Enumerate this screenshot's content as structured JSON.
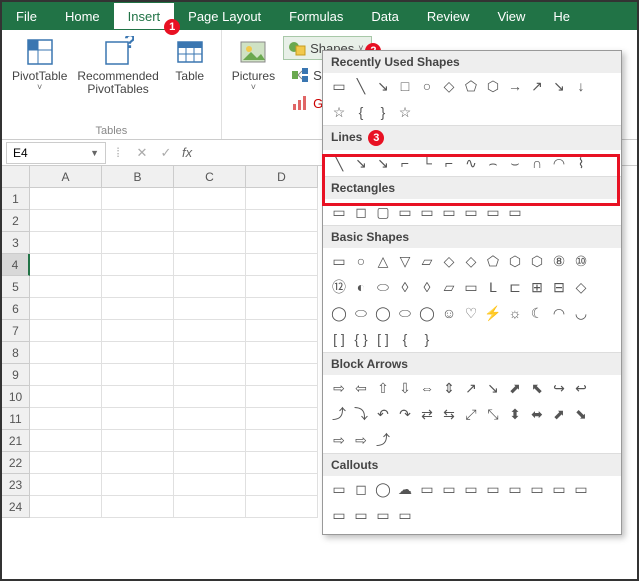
{
  "tabs": [
    "File",
    "Home",
    "Insert",
    "Page Layout",
    "Formulas",
    "Data",
    "Review",
    "View",
    "He"
  ],
  "active_tab": 2,
  "annotations": {
    "tab": "1",
    "shapes": "2",
    "lines": "3"
  },
  "ribbon": {
    "tables_group": "Tables",
    "pivottable": "PivotTable",
    "recommended": "Recommended\nPivotTables",
    "table": "Table",
    "pictures": "Pictures",
    "shapes": "Shapes",
    "smartart": "SmartArt",
    "g": "G"
  },
  "namebox": "E4",
  "fx": "fx",
  "cancel": "✕",
  "accept": "✓",
  "cols": [
    "A",
    "B",
    "C",
    "D"
  ],
  "rows": [
    "1",
    "2",
    "3",
    "4",
    "5",
    "6",
    "7",
    "8",
    "9",
    "10",
    "11",
    "21",
    "22",
    "23",
    "24"
  ],
  "selected_row_idx": 3,
  "gallery": {
    "sections": [
      {
        "title": "Recently Used Shapes",
        "rows": [
          [
            "▭",
            "╲",
            "↘",
            "□",
            "○",
            "◇",
            "⬠",
            "⬡",
            "→",
            "↗",
            "↘",
            "↓"
          ],
          [
            "☆",
            "{",
            "}",
            "☆"
          ]
        ]
      },
      {
        "title": "Lines",
        "rows": [
          [
            "╲",
            "↘",
            "↘",
            "⌐",
            "└",
            "⌐",
            "∿",
            "⌢",
            "⌣",
            "∩",
            "◠",
            "⌇"
          ]
        ]
      },
      {
        "title": "Rectangles",
        "rows": [
          [
            "▭",
            "◻",
            "▢",
            "▭",
            "▭",
            "▭",
            "▭",
            "▭",
            "▭"
          ]
        ]
      },
      {
        "title": "Basic Shapes",
        "rows": [
          [
            "▭",
            "○",
            "△",
            "▽",
            "▱",
            "◇",
            "◇",
            "⬠",
            "⬡",
            "⬡",
            "⑧",
            "⑩"
          ],
          [
            "⑫",
            "◐",
            "⬭",
            "◊",
            "◊",
            "▱",
            "▭",
            "L",
            "⊏",
            "⊞",
            "⊟",
            "◇"
          ],
          [
            "◯",
            "⬭",
            "◯",
            "⬭",
            "◯",
            "☺",
            "♡",
            "⚡",
            "☼",
            "☾",
            "◠",
            "◡"
          ],
          [
            "[ ]",
            "{ }",
            "[ ]",
            "{",
            "}"
          ]
        ]
      },
      {
        "title": "Block Arrows",
        "rows": [
          [
            "⇨",
            "⇦",
            "⇧",
            "⇩",
            "⇔",
            "⇕",
            "↗",
            "↘",
            "⬈",
            "⬉",
            "↪",
            "↩"
          ],
          [
            "⤴",
            "⤵",
            "↶",
            "↷",
            "⇄",
            "⇆",
            "⤢",
            "⤡",
            "⬍",
            "⬌",
            "⬈",
            "⬊"
          ],
          [
            "⇨",
            "⇨",
            "⤴"
          ]
        ]
      },
      {
        "title": "Callouts",
        "rows": [
          [
            "▭",
            "◻",
            "◯",
            "☁",
            "▭",
            "▭",
            "▭",
            "▭",
            "▭",
            "▭",
            "▭",
            "▭"
          ],
          [
            "▭",
            "▭",
            "▭",
            "▭"
          ]
        ]
      }
    ]
  }
}
